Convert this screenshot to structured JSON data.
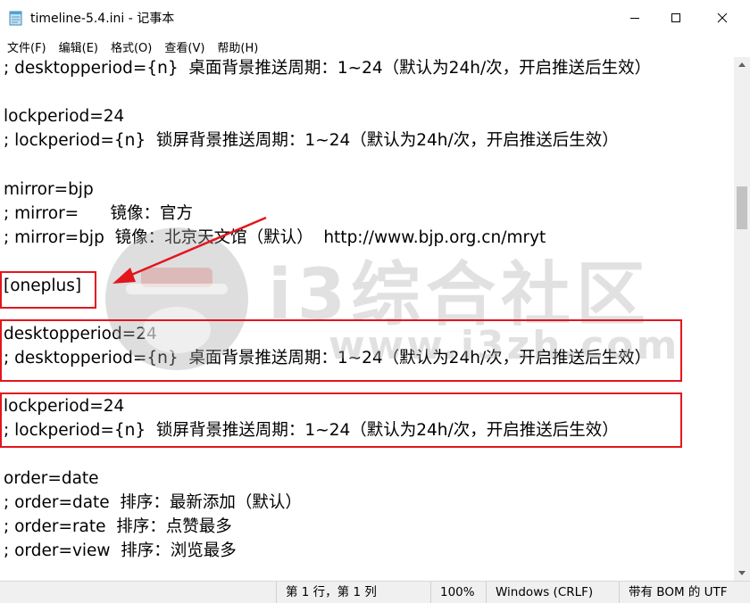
{
  "window": {
    "title": "timeline-5.4.ini - 记事本"
  },
  "menu": [
    "文件(F)",
    "编辑(E)",
    "格式(O)",
    "查看(V)",
    "帮助(H)"
  ],
  "editor": {
    "lines": [
      "; desktopperiod={n}  桌面背景推送周期：1~24（默认为24h/次，开启推送后生效）",
      "",
      "lockperiod=24",
      "; lockperiod={n}  锁屏背景推送周期：1~24（默认为24h/次，开启推送后生效）",
      "",
      "mirror=bjp",
      "; mirror=      镜像：官方",
      "; mirror=bjp  镜像：北京天文馆（默认）  http://www.bjp.org.cn/mryt",
      "",
      "[oneplus]",
      "",
      "desktopperiod=24",
      "; desktopperiod={n}  桌面背景推送周期：1~24（默认为24h/次，开启推送后生效）",
      "",
      "lockperiod=24",
      "; lockperiod={n}  锁屏背景推送周期：1~24（默认为24h/次，开启推送后生效）",
      "",
      "order=date",
      "; order=date  排序：最新添加（默认）",
      "; order=rate  排序：点赞最多",
      "; order=view  排序：浏览最多"
    ]
  },
  "watermark": {
    "text": "i3综合社区",
    "url": "www.i3zh.com"
  },
  "status": {
    "position": "第 1 行，第 1 列",
    "zoom": "100%",
    "line_ending": "Windows (CRLF)",
    "encoding": "带有 BOM 的 UTF"
  },
  "colors": {
    "annotation": "#e3161d",
    "statusbar_bg": "#f0f0f0"
  }
}
